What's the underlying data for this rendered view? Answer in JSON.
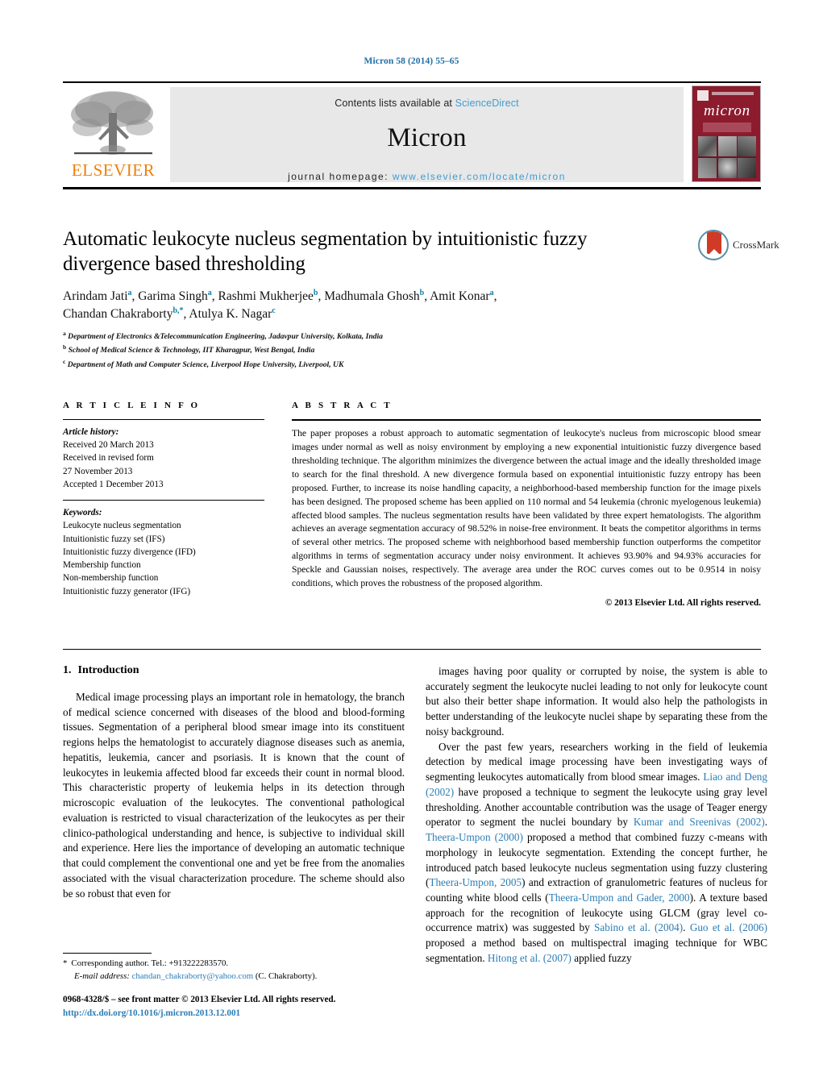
{
  "running_head": "Micron 58 (2014) 55–65",
  "masthead": {
    "publisher_logo_word": "ELSEVIER",
    "contents_prefix": "Contents lists available at ",
    "contents_link": "ScienceDirect",
    "journal_title": "Micron",
    "homepage_prefix": "journal homepage: ",
    "homepage_url": "www.elsevier.com/locate/micron",
    "cover_journal_name": "micron"
  },
  "article": {
    "title": "Automatic leukocyte nucleus segmentation by intuitionistic fuzzy divergence based thresholding",
    "crossmark_label": "CrossMark",
    "authors_line1_parts": [
      {
        "name": "Arindam Jati",
        "sup": "a",
        "sep": ", "
      },
      {
        "name": "Garima Singh",
        "sup": "a",
        "sep": ", "
      },
      {
        "name": "Rashmi Mukherjee",
        "sup": "b",
        "sep": ", "
      },
      {
        "name": "Madhumala Ghosh",
        "sup": "b",
        "sep": ", "
      },
      {
        "name": "Amit Konar",
        "sup": "a",
        "sep": ","
      }
    ],
    "authors_line2_parts": [
      {
        "name": "Chandan Chakraborty",
        "sup": "b,",
        "star": "*",
        "sep": ", "
      },
      {
        "name": "Atulya K. Nagar",
        "sup": "c",
        "sep": ""
      }
    ],
    "affiliations": [
      {
        "marker": "a",
        "text": "Department of Electronics &Telecommunication Engineering, Jadavpur University, Kolkata, India"
      },
      {
        "marker": "b",
        "text": "School of Medical Science & Technology, IIT Kharagpur, West Bengal, India"
      },
      {
        "marker": "c",
        "text": "Department of Math and Computer Science, Liverpool Hope University, Liverpool, UK"
      }
    ]
  },
  "article_info": {
    "heading": "A R T I C L E   I N F O",
    "history_label": "Article history:",
    "history": [
      "Received 20 March 2013",
      "Received in revised form",
      "27 November 2013",
      "Accepted 1 December 2013"
    ],
    "keywords_label": "Keywords:",
    "keywords": [
      "Leukocyte nucleus segmentation",
      "Intuitionistic fuzzy set (IFS)",
      "Intuitionistic fuzzy divergence (IFD)",
      "Membership function",
      "Non-membership function",
      "Intuitionistic fuzzy generator (IFG)"
    ]
  },
  "abstract": {
    "heading": "A B S T R A C T",
    "text": "The paper proposes a robust approach to automatic segmentation of leukocyte's nucleus from microscopic blood smear images under normal as well as noisy environment by employing a new exponential intuitionistic fuzzy divergence based thresholding technique. The algorithm minimizes the divergence between the actual image and the ideally thresholded image to search for the final threshold. A new divergence formula based on exponential intuitionistic fuzzy entropy has been proposed. Further, to increase its noise handling capacity, a neighborhood-based membership function for the image pixels has been designed. The proposed scheme has been applied on 110 normal and 54 leukemia (chronic myelogenous leukemia) affected blood samples. The nucleus segmentation results have been validated by three expert hematologists. The algorithm achieves an average segmentation accuracy of 98.52% in noise-free environment. It beats the competitor algorithms in terms of several other metrics. The proposed scheme with neighborhood based membership function outperforms the competitor algorithms in terms of segmentation accuracy under noisy environment. It achieves 93.90% and 94.93% accuracies for Speckle and Gaussian noises, respectively. The average area under the ROC curves comes out to be 0.9514 in noisy conditions, which proves the robustness of the proposed algorithm.",
    "copyright": "© 2013 Elsevier Ltd. All rights reserved."
  },
  "body": {
    "section_number": "1.",
    "section_title": "Introduction",
    "left_paragraph_1": "Medical image processing plays an important role in hematology, the branch of medical science concerned with diseases of the blood and blood-forming tissues. Segmentation of a peripheral blood smear image into its constituent regions helps the hematologist to accurately diagnose diseases such as anemia, hepatitis, leukemia, cancer and psoriasis. It is known that the count of leukocytes in leukemia affected blood far exceeds their count in normal blood. This characteristic property of leukemia helps in its detection through microscopic evaluation of the leukocytes. The conventional pathological evaluation is restricted to visual characterization of the leukocytes as per their clinico-pathological understanding and hence, is subjective to individual skill and experience. Here lies the importance of developing an automatic technique that could complement the conventional one and yet be free from the anomalies associated with the visual characterization procedure. The scheme should also be so robust that even for",
    "right_paragraph_1": "images having poor quality or corrupted by noise, the system is able to accurately segment the leukocyte nuclei leading to not only for leukocyte count but also their better shape information. It would also help the pathologists in better understanding of the leukocyte nuclei shape by separating these from the noisy background.",
    "right_paragraph_2_segments": [
      {
        "t": "Over the past few years, researchers working in the field of leukemia detection by medical image processing have been investigating ways of segmenting leukocytes automatically from blood smear images. ",
        "ref": false
      },
      {
        "t": "Liao and Deng (2002)",
        "ref": true
      },
      {
        "t": " have proposed a technique to segment the leukocyte using gray level thresholding. Another accountable contribution was the usage of Teager energy operator to segment the nuclei boundary by ",
        "ref": false
      },
      {
        "t": "Kumar and Sreenivas (2002)",
        "ref": true
      },
      {
        "t": ". ",
        "ref": false
      },
      {
        "t": "Theera-Umpon (2000)",
        "ref": true
      },
      {
        "t": " proposed a method that combined fuzzy c-means with morphology in leukocyte segmentation. Extending the concept further, he introduced patch based leukocyte nucleus segmentation using fuzzy clustering (",
        "ref": false
      },
      {
        "t": "Theera-Umpon, 2005",
        "ref": true
      },
      {
        "t": ") and extraction of granulometric features of nucleus for counting white blood cells (",
        "ref": false
      },
      {
        "t": "Theera-Umpon and Gader, 2000",
        "ref": true
      },
      {
        "t": "). A texture based approach for the recognition of leukocyte using GLCM (gray level co-occurrence matrix) was suggested by ",
        "ref": false
      },
      {
        "t": "Sabino et al. (2004)",
        "ref": true
      },
      {
        "t": ". ",
        "ref": false
      },
      {
        "t": "Guo et al. (2006)",
        "ref": true
      },
      {
        "t": " proposed a method based on multispectral imaging technique for WBC segmentation. ",
        "ref": false
      },
      {
        "t": "Hitong et al. (2007)",
        "ref": true
      },
      {
        "t": " applied fuzzy",
        "ref": false
      }
    ]
  },
  "footer": {
    "corresponding_star": "*",
    "corresponding_text": "Corresponding author. Tel.: +913222283570.",
    "email_label": "E-mail address:",
    "email": "chandan_chakraborty@yahoo.com",
    "email_owner": "(C. Chakraborty).",
    "imprint": "0968-4328/$ – see front matter © 2013 Elsevier Ltd. All rights reserved.",
    "doi": "http://dx.doi.org/10.1016/j.micron.2013.12.001"
  },
  "colors": {
    "link": "#2b7db5",
    "science_direct": "#3f9bd0",
    "elsevier_orange": "#f07f09",
    "cover_maroon": "#8c1b2e",
    "superscript_teal": "#0f7fa5"
  }
}
